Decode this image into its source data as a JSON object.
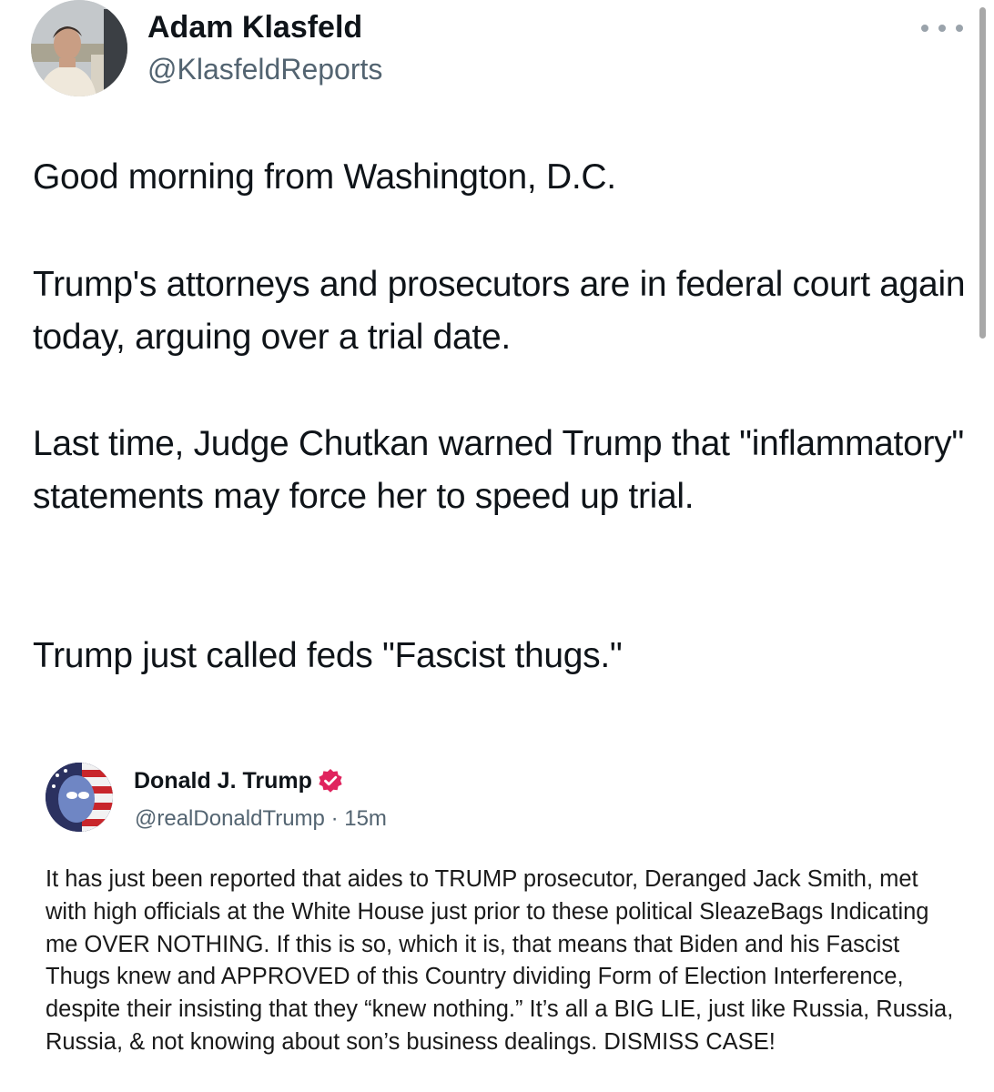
{
  "tweet": {
    "author_name": "Adam Klasfeld",
    "author_handle": "@KlasfeldReports",
    "paragraphs": [
      "Good morning from Washington, D.C.",
      "Trump's attorneys and prosecutors are in federal court again today, arguing over a trial date.",
      "Last time, Judge Chutkan warned Trump that \"inflammatory\" statements may force her to speed up trial.",
      "Trump just called feds \"Fascist thugs.\""
    ],
    "more_icon": "more-horizontal-icon"
  },
  "embedded_post": {
    "author_name": "Donald J. Trump",
    "verified_icon": "verified-badge-icon",
    "author_handle": "@realDonaldTrump",
    "separator": "·",
    "timestamp": "15m",
    "text": "It has just been reported that aides to TRUMP prosecutor, Deranged Jack Smith, met with high officials at the White House just prior to these political SleazeBags Indicating me OVER NOTHING. If this is so, which it is, that means that Biden and his Fascist Thugs knew and APPROVED of this Country dividing Form of Election Interference, despite their insisting that they “knew nothing.” It’s all a BIG LIE, just like Russia, Russia, Russia, & not knowing about son’s business dealings. DISMISS CASE!"
  },
  "colors": {
    "text_primary": "#0f1419",
    "text_secondary": "#536471",
    "verified_badge": "#e0245e"
  }
}
